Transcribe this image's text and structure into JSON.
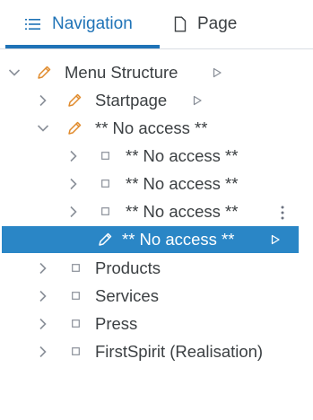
{
  "tabs": {
    "navigation_label": "Navigation",
    "page_label": "Page"
  },
  "tree": {
    "root_label": "Menu Structure",
    "startpage_label": "Startpage",
    "no_access_parent_label": "** No access **",
    "child1_label": "** No access **",
    "child2_label": "** No access **",
    "child3_label": "** No access **",
    "selected_label": "** No access **",
    "products_label": "Products",
    "services_label": "Services",
    "press_label": "Press",
    "firstspirit_label": "FirstSpirit (Realisation)"
  },
  "colors": {
    "accent": "#1f73b7",
    "selected_bg": "#2a86c6",
    "pencil": "#e08a2b",
    "text": "#3c4043"
  }
}
